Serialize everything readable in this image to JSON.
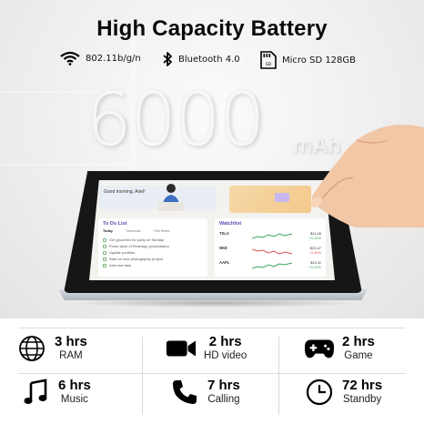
{
  "title": "High Capacity Battery",
  "specs": {
    "wifi": "802.11b/g/n",
    "bluetooth": "Bluetooth 4.0",
    "storage": "Micro SD 128GB"
  },
  "capacity": {
    "value": "6000",
    "unit": "mAh"
  },
  "screen": {
    "banner": "Good morning, Ariel!",
    "todo_title": "To Do List",
    "todo_tabs": [
      "Today",
      "Tomorrow",
      "This Week"
    ],
    "todo_items": [
      "Get groceries for party on Sunday",
      "Finish deck of Redesign presentation",
      "Update portfolio",
      "Start on new photography project",
      "Add new task"
    ],
    "watch_title": "Watchlist",
    "watch_rows": [
      {
        "ticker": "TSLA",
        "price": "$11.46",
        "change": "+0.12%"
      },
      {
        "ticker": "NKE",
        "price": "$22.47",
        "change": "-0.40%"
      },
      {
        "ticker": "AAPL",
        "price": "$13.11",
        "change": "+0.41%"
      }
    ]
  },
  "stats": [
    {
      "hours": "3 hrs",
      "label": "RAM",
      "icon": "globe-icon"
    },
    {
      "hours": "2 hrs",
      "label": "HD video",
      "icon": "video-camera-icon"
    },
    {
      "hours": "2 hrs",
      "label": "Game",
      "icon": "gamepad-icon"
    },
    {
      "hours": "6 hrs",
      "label": "Music",
      "icon": "music-note-icon"
    },
    {
      "hours": "7 hrs",
      "label": "Calling",
      "icon": "phone-icon"
    },
    {
      "hours": "72 hrs",
      "label": "Standby",
      "icon": "clock-icon"
    }
  ]
}
